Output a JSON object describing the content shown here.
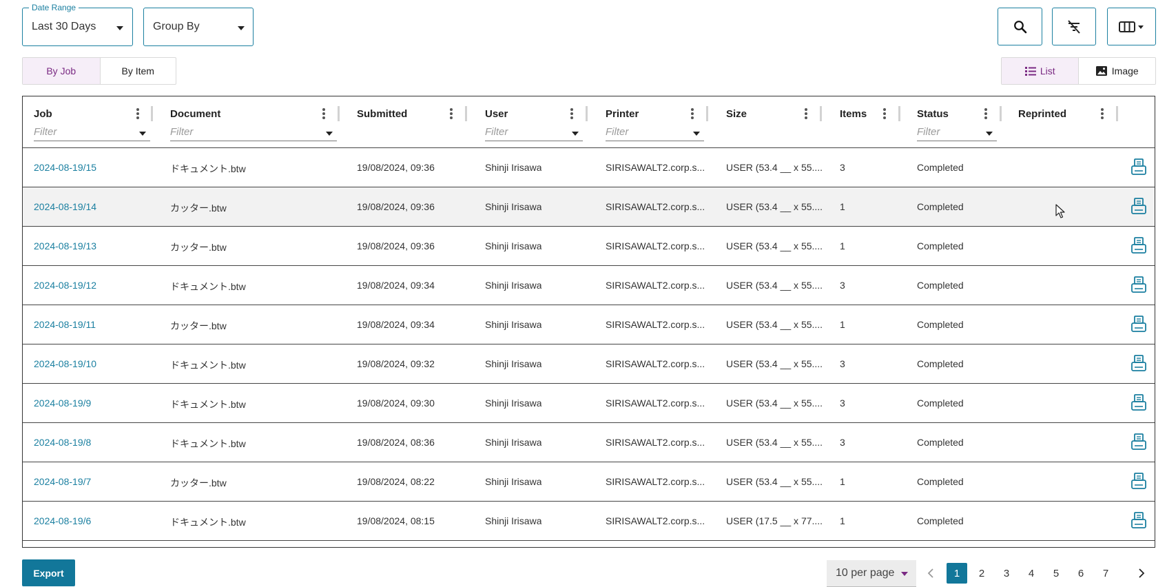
{
  "toolbar": {
    "date_range_label": "Date Range",
    "date_range_value": "Last 30 Days",
    "group_by_value": "Group By"
  },
  "view_tabs": {
    "by_job": "By Job",
    "by_item": "By Item"
  },
  "layout_tabs": {
    "list": "List",
    "image": "Image"
  },
  "columns": {
    "job": "Job",
    "document": "Document",
    "submitted": "Submitted",
    "user": "User",
    "printer": "Printer",
    "size": "Size",
    "items": "Items",
    "status": "Status",
    "reprinted": "Reprinted"
  },
  "filter_placeholder": "Filter",
  "rows": [
    {
      "job": "2024-08-19/15",
      "document": "ドキュメント.btw",
      "submitted": "19/08/2024, 09:36",
      "user": "Shinji Irisawa",
      "printer": "SIRISAWALT2.corp.s...",
      "size": "USER (53.4 __ x 55....",
      "items": "3",
      "status": "Completed"
    },
    {
      "job": "2024-08-19/14",
      "document": "カッター.btw",
      "submitted": "19/08/2024, 09:36",
      "user": "Shinji Irisawa",
      "printer": "SIRISAWALT2.corp.s...",
      "size": "USER (53.4 __ x 55....",
      "items": "1",
      "status": "Completed"
    },
    {
      "job": "2024-08-19/13",
      "document": "カッター.btw",
      "submitted": "19/08/2024, 09:36",
      "user": "Shinji Irisawa",
      "printer": "SIRISAWALT2.corp.s...",
      "size": "USER (53.4 __ x 55....",
      "items": "1",
      "status": "Completed"
    },
    {
      "job": "2024-08-19/12",
      "document": "ドキュメント.btw",
      "submitted": "19/08/2024, 09:34",
      "user": "Shinji Irisawa",
      "printer": "SIRISAWALT2.corp.s...",
      "size": "USER (53.4 __ x 55....",
      "items": "3",
      "status": "Completed"
    },
    {
      "job": "2024-08-19/11",
      "document": "カッター.btw",
      "submitted": "19/08/2024, 09:34",
      "user": "Shinji Irisawa",
      "printer": "SIRISAWALT2.corp.s...",
      "size": "USER (53.4 __ x 55....",
      "items": "1",
      "status": "Completed"
    },
    {
      "job": "2024-08-19/10",
      "document": "ドキュメント.btw",
      "submitted": "19/08/2024, 09:32",
      "user": "Shinji Irisawa",
      "printer": "SIRISAWALT2.corp.s...",
      "size": "USER (53.4 __ x 55....",
      "items": "3",
      "status": "Completed"
    },
    {
      "job": "2024-08-19/9",
      "document": "ドキュメント.btw",
      "submitted": "19/08/2024, 09:30",
      "user": "Shinji Irisawa",
      "printer": "SIRISAWALT2.corp.s...",
      "size": "USER (53.4 __ x 55....",
      "items": "3",
      "status": "Completed"
    },
    {
      "job": "2024-08-19/8",
      "document": "ドキュメント.btw",
      "submitted": "19/08/2024, 08:36",
      "user": "Shinji Irisawa",
      "printer": "SIRISAWALT2.corp.s...",
      "size": "USER (53.4 __ x 55....",
      "items": "3",
      "status": "Completed"
    },
    {
      "job": "2024-08-19/7",
      "document": "カッター.btw",
      "submitted": "19/08/2024, 08:22",
      "user": "Shinji Irisawa",
      "printer": "SIRISAWALT2.corp.s...",
      "size": "USER (53.4 __ x 55....",
      "items": "1",
      "status": "Completed"
    },
    {
      "job": "2024-08-19/6",
      "document": "ドキュメント.btw",
      "submitted": "19/08/2024, 08:15",
      "user": "Shinji Irisawa",
      "printer": "SIRISAWALT2.corp.s...",
      "size": "USER (17.5 __ x 77....",
      "items": "1",
      "status": "Completed"
    }
  ],
  "hovered_row": 2,
  "footer": {
    "export_label": "Export",
    "per_page": "10 per page",
    "pages": [
      "1",
      "2",
      "3",
      "4",
      "5",
      "6",
      "7"
    ],
    "current_page": "1"
  },
  "icons": {
    "search": "search-icon",
    "clear_filters": "filter-off-icon",
    "columns": "columns-icon",
    "list": "list-icon",
    "image": "image-icon",
    "reprint": "printer-icon"
  },
  "colors": {
    "accent": "#1a7fa0",
    "primary_button": "#12779a",
    "active_tab_bg": "#f6eef8",
    "active_tab_text": "#7a2a83"
  }
}
